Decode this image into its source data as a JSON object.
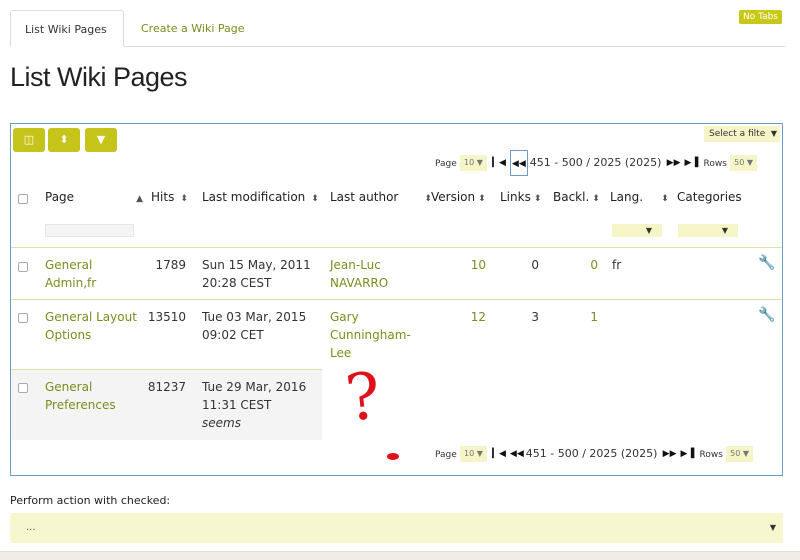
{
  "tabs": [
    {
      "label": "List Wiki Pages"
    },
    {
      "label": "Create a Wiki Page"
    }
  ],
  "no_tabs_label": "No Tabs",
  "page_title": "List Wiki Pages",
  "toolbar": {
    "buttons": [
      {
        "icon": "columns-icon",
        "glyph": "◫"
      },
      {
        "icon": "sort-icon",
        "glyph": "⬍"
      },
      {
        "icon": "filter-icon",
        "glyph": "▼"
      }
    ]
  },
  "filter_select": {
    "label": "Select a filte"
  },
  "pager": {
    "page_label": "Page",
    "page_value": "10",
    "range": "451 - 500 / 2025 (2025)",
    "rows_label": "Rows",
    "rows_value": "50"
  },
  "columns": [
    {
      "label": "Page"
    },
    {
      "label": "Hits"
    },
    {
      "label": "Last modification"
    },
    {
      "label": "Last author"
    },
    {
      "label": "Version"
    },
    {
      "label": "Links"
    },
    {
      "label": "Backl."
    },
    {
      "label": "Lang."
    },
    {
      "label": "Categories"
    }
  ],
  "rows": [
    {
      "page_l1": "General",
      "page_l2": "Admin,fr",
      "hits": "1789",
      "mod_l1": "Sun 15 May, 2011",
      "mod_l2": "20:28 CEST",
      "author_l1": "Jean-Luc",
      "author_l2": "NAVARRO",
      "author_l3": "",
      "version": "10",
      "links": "0",
      "backl": "0",
      "lang": "fr"
    },
    {
      "page_l1": "General Layout",
      "page_l2": "Options",
      "hits": "13510",
      "mod_l1": "Tue 03 Mar, 2015",
      "mod_l2": "09:02 CET",
      "author_l1": "Gary",
      "author_l2": "Cunningham-",
      "author_l3": "Lee",
      "version": "12",
      "links": "3",
      "backl": "1",
      "lang": ""
    },
    {
      "page_l1": "General",
      "page_l2": "Preferences",
      "hits": "81237",
      "mod_l1": "Tue 29 Mar, 2016",
      "mod_l2": "11:31 CEST",
      "mod_l3": "seems"
    }
  ],
  "annotation": {
    "text": "?"
  },
  "bottom": {
    "perform_label": "Perform action with checked:",
    "action_value": "..."
  },
  "colors": {
    "accent": "#c4c41a",
    "link": "#7a8c1f",
    "border": "#6e9ac6",
    "annotation": "#e0101a"
  }
}
